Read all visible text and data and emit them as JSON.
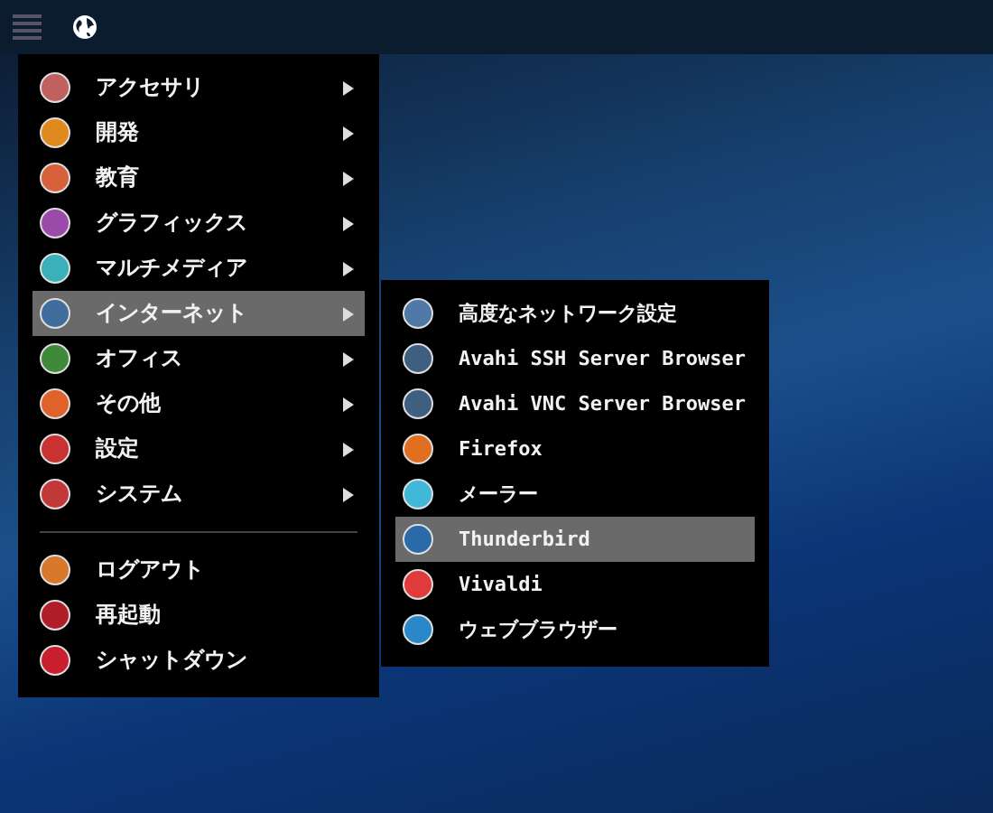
{
  "menu": {
    "items": [
      {
        "label": "アクセサリ",
        "color": "#c0605f",
        "selected": false
      },
      {
        "label": "開発",
        "color": "#e08a1e",
        "selected": false
      },
      {
        "label": "教育",
        "color": "#d8603a",
        "selected": false
      },
      {
        "label": "グラフィックス",
        "color": "#9a4aa8",
        "selected": false
      },
      {
        "label": "マルチメディア",
        "color": "#3ab0b8",
        "selected": false
      },
      {
        "label": "インターネット",
        "color": "#3f6e9e",
        "selected": true
      },
      {
        "label": "オフィス",
        "color": "#3f8a3a",
        "selected": false
      },
      {
        "label": "その他",
        "color": "#e0622a",
        "selected": false
      },
      {
        "label": "設定",
        "color": "#c83232",
        "selected": false
      },
      {
        "label": "システム",
        "color": "#c23838",
        "selected": false
      }
    ],
    "actions": [
      {
        "label": "ログアウト",
        "color": "#d8782a"
      },
      {
        "label": "再起動",
        "color": "#b01e2a"
      },
      {
        "label": "シャットダウン",
        "color": "#c81e2e"
      }
    ]
  },
  "submenu": {
    "items": [
      {
        "label": "高度なネットワーク設定",
        "color": "#4f7aa8",
        "selected": false
      },
      {
        "label": "Avahi SSH Server Browser",
        "color": "#3f5f80",
        "selected": false
      },
      {
        "label": "Avahi VNC Server Browser",
        "color": "#3f5f80",
        "selected": false
      },
      {
        "label": "Firefox",
        "color": "#e07020",
        "selected": false
      },
      {
        "label": "メーラー",
        "color": "#40b8d8",
        "selected": false
      },
      {
        "label": "Thunderbird",
        "color": "#2a6aa8",
        "selected": true
      },
      {
        "label": "Vivaldi",
        "color": "#e03a3a",
        "selected": false
      },
      {
        "label": "ウェブブラウザー",
        "color": "#2a88c8",
        "selected": false
      }
    ]
  }
}
